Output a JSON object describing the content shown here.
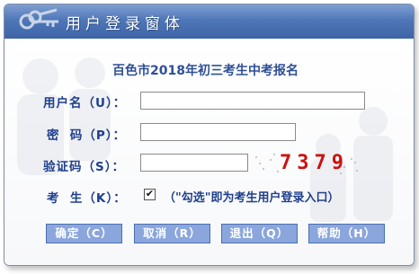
{
  "window": {
    "title": "用户登录窗体"
  },
  "form": {
    "heading": "百色市2018年初三考生中考报名",
    "username_label": "用户名（U）：",
    "username_value": "",
    "password_label": "密  码（P）：",
    "password_value": "",
    "captcha_label": "验证码（S）：",
    "captcha_value": "",
    "captcha_image_text": "7379",
    "examinee_label": "考  生（K）：",
    "examinee_checked": true,
    "examinee_hint": "（\"勾选\"即为考生用户登录入口）"
  },
  "buttons": {
    "confirm": "确定（C）",
    "cancel": "取消（R）",
    "exit": "退出（Q）",
    "help": "帮助（H）"
  },
  "icons": {
    "title_icon": "keys-icon",
    "checkbox_mark": "✔"
  },
  "colors": {
    "titlebar": "#4f77b8",
    "label": "#1f3f8d",
    "button": "#8aa6dc",
    "captcha": "#cc1111"
  }
}
